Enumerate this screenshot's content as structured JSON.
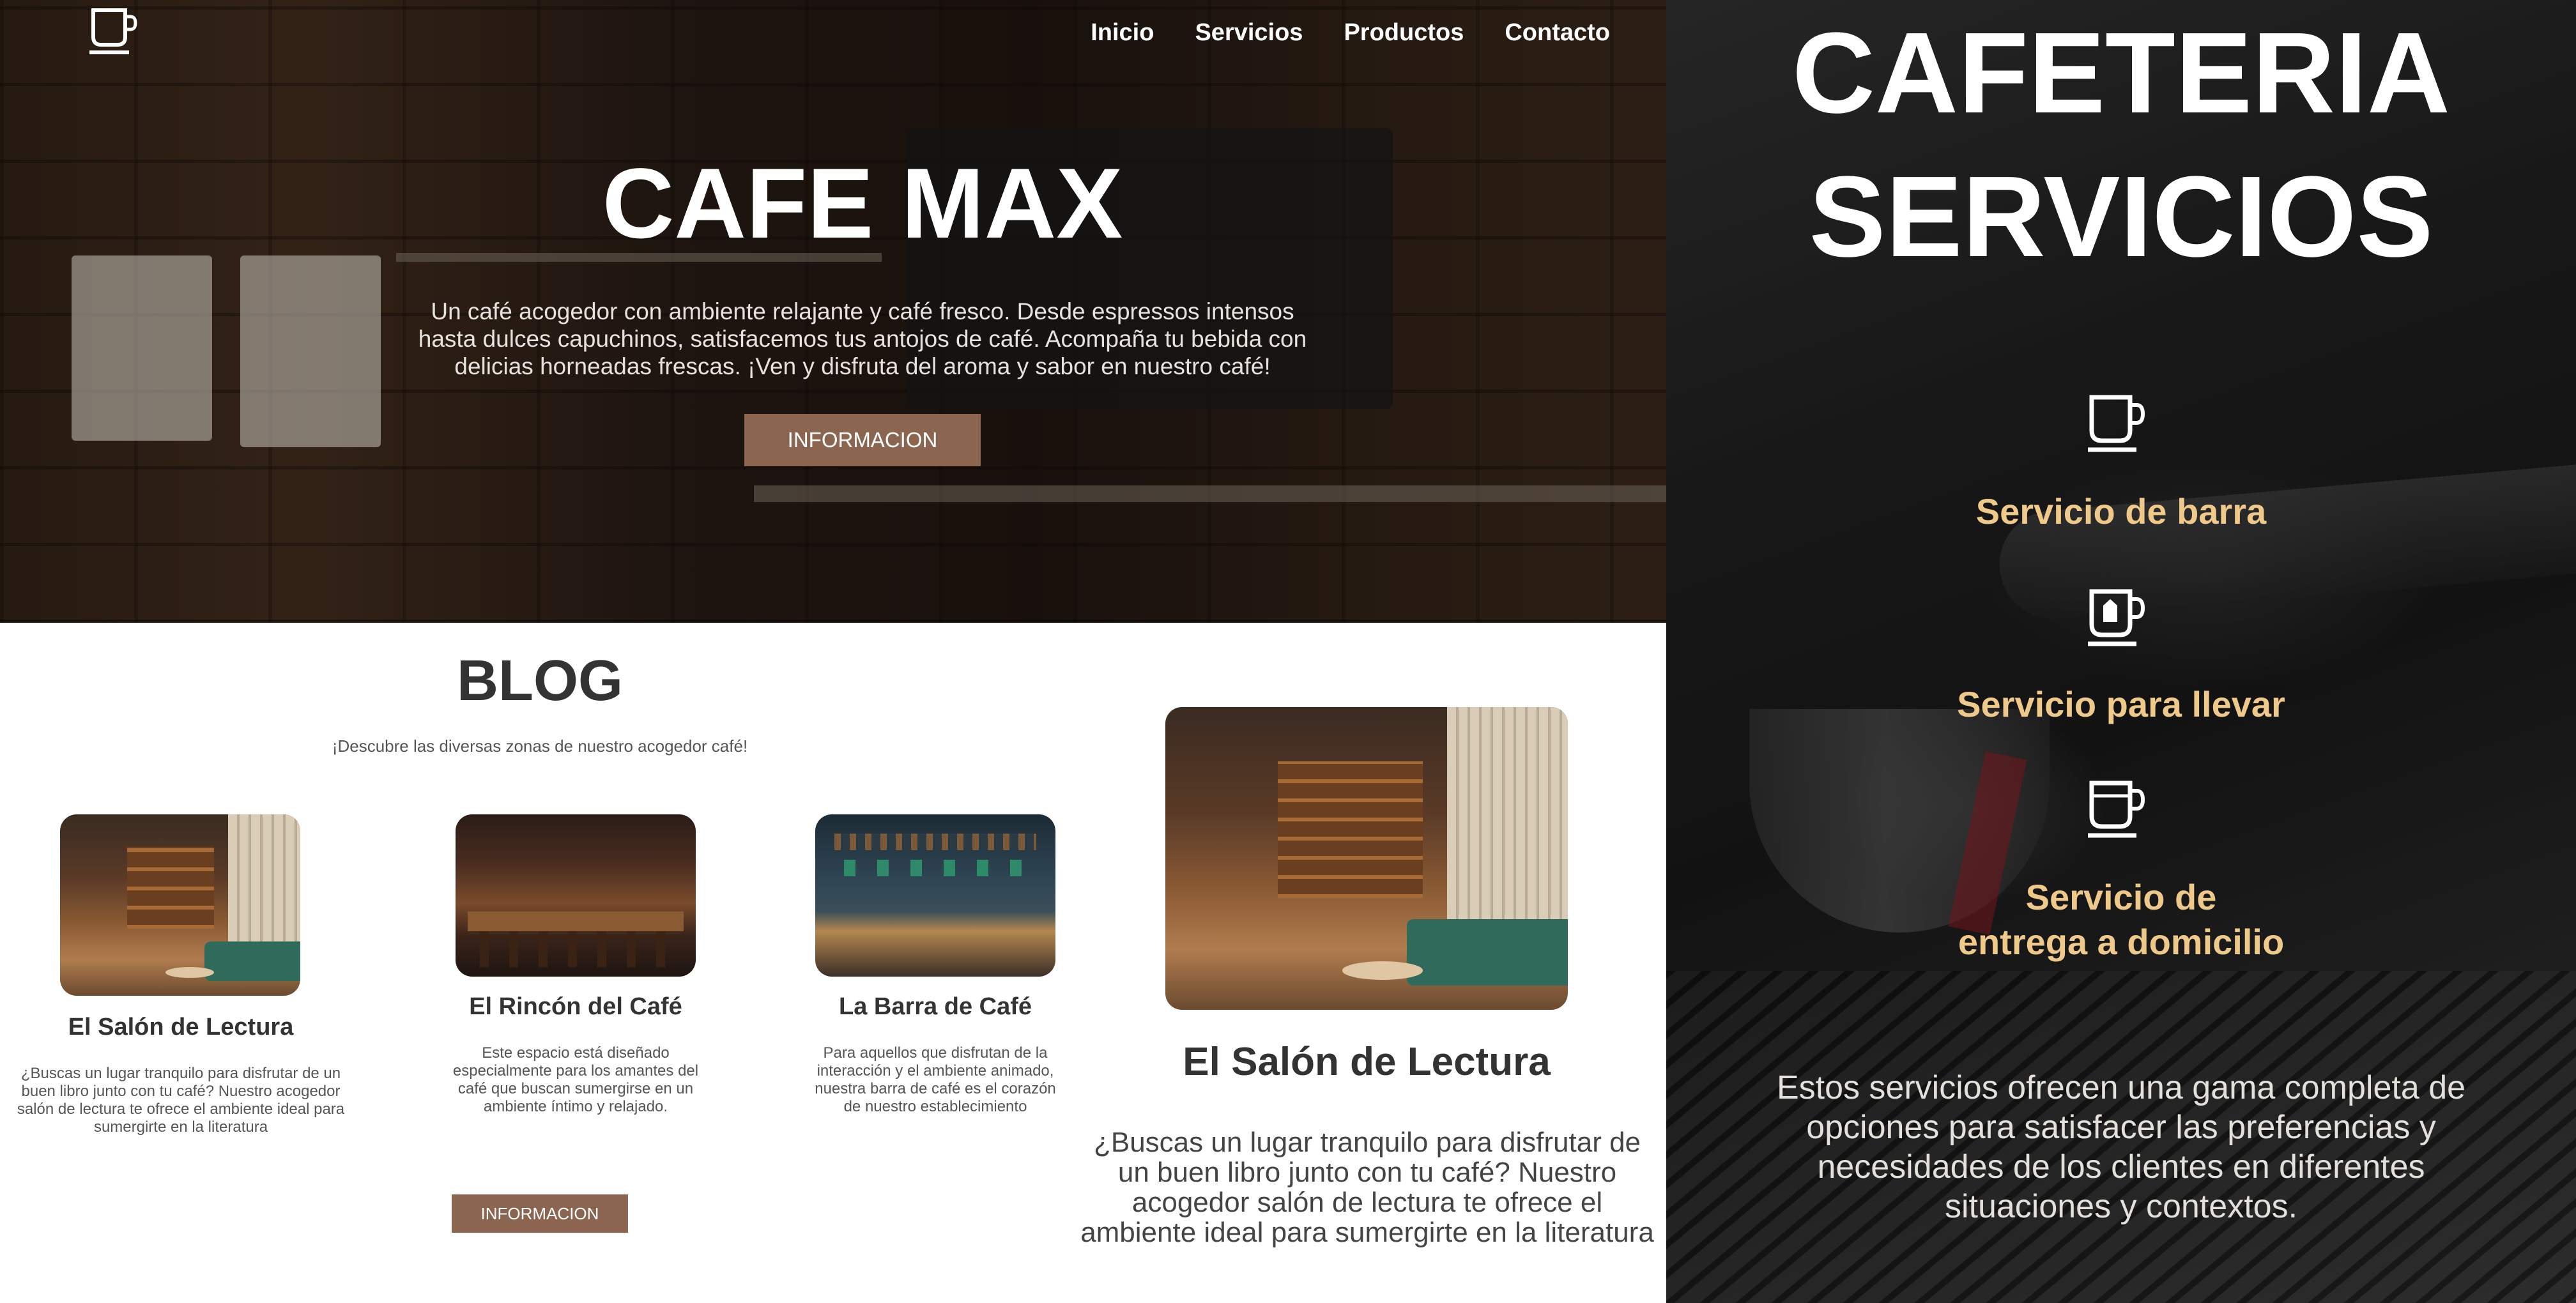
{
  "nav": {
    "logo_icon": "coffee-cup-icon",
    "items": [
      {
        "label": "Inicio"
      },
      {
        "label": "Servicios"
      },
      {
        "label": "Productos"
      },
      {
        "label": "Contacto"
      }
    ]
  },
  "hero": {
    "title": "CAFE MAX",
    "text": "Un café acogedor con ambiente relajante y café fresco. Desde espressos intensos hasta dulces capuchinos, satisfacemos tus antojos de café. Acompaña tu bebida con delicias horneadas frescas. ¡Ven y disfruta del aroma y sabor en nuestro café!",
    "button": "INFORMACION"
  },
  "blog": {
    "title": "BLOG",
    "subtitle": "¡Descubre las diversas zonas de nuestro acogedor café!",
    "button": "INFORMACION",
    "cards": [
      {
        "title": "El Salón de Lectura",
        "text": "¿Buscas un lugar tranquilo para disfrutar de un buen libro junto con tu café? Nuestro acogedor salón de lectura te ofrece el ambiente ideal para sumergirte en la literatura"
      },
      {
        "title": "El Rincón del Café",
        "text": "Este espacio está diseñado especialmente para los amantes del café que buscan sumergirse en un ambiente íntimo y relajado."
      },
      {
        "title": "La Barra de Café",
        "text": "Para aquellos que disfrutan de la interacción y el ambiente animado, nuestra barra de café es el corazón de nuestro establecimiento"
      }
    ],
    "featured": {
      "title": "El Salón de Lectura",
      "text": "¿Buscas un lugar tranquilo para disfrutar de un buen libro junto con tu café? Nuestro acogedor salón de lectura te ofrece el ambiente ideal para sumergirte en la literatura"
    }
  },
  "services": {
    "title_line1": "CAFETERIA",
    "title_line2": "SERVICIOS",
    "items": [
      {
        "icon": "coffee-cup-icon",
        "line1": "Servicio de barra",
        "line2": ""
      },
      {
        "icon": "takeaway-cup-icon",
        "line1": "Servicio para llevar",
        "line2": ""
      },
      {
        "icon": "delivery-cup-icon",
        "line1": "Servicio de",
        "line2": "entrega a domicilio"
      }
    ],
    "text": "Estos servicios ofrecen una gama completa de opciones para satisfacer las preferencias y necesidades de los clientes en diferentes situaciones y contextos."
  },
  "colors": {
    "accent_button": "#8c6551",
    "service_gold": "#efc98a"
  }
}
